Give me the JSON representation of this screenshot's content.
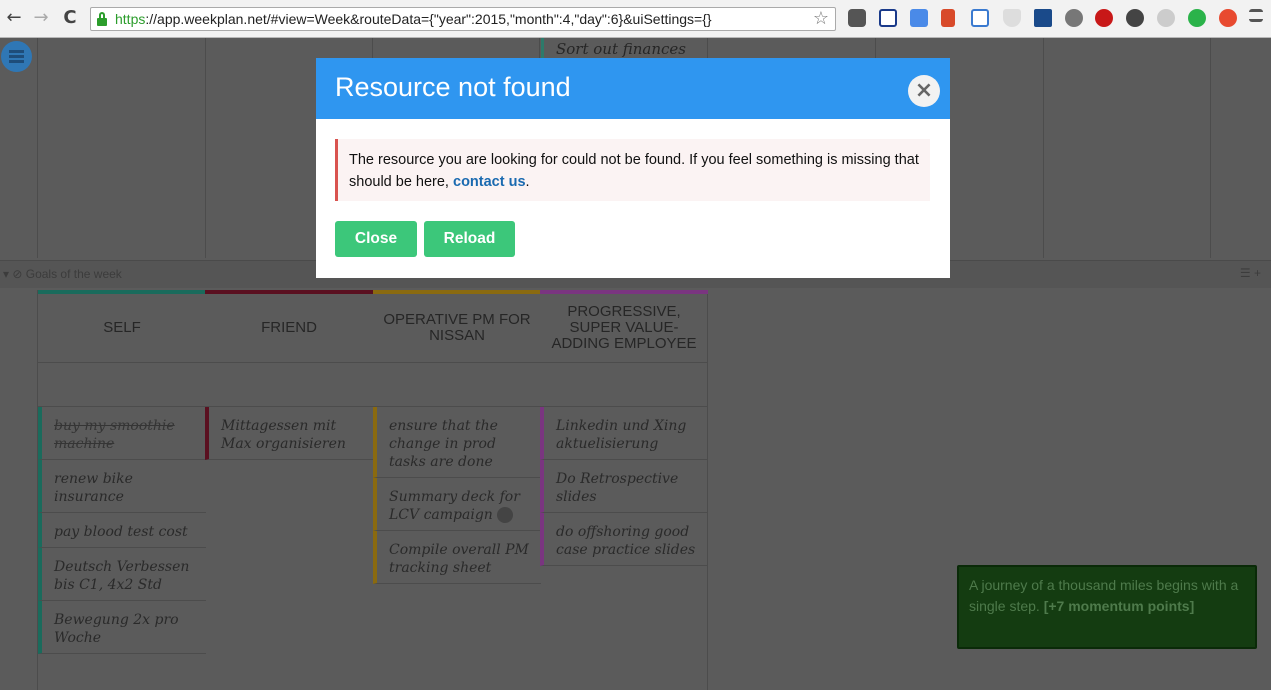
{
  "browser": {
    "back_glyph": "←",
    "forward_glyph": "→",
    "reload_glyph": "C",
    "url_scheme": "https",
    "url_rest": "://app.weekplan.net/#view=Week&routeData={\"year\":2015,\"month\":4,\"day\":6}&uiSettings={}",
    "star_glyph": "☆"
  },
  "schedule": {
    "task": "Sort out finances"
  },
  "goals_bar": {
    "label": "▾ ⊘ Goals of the week",
    "icons": "☰  +"
  },
  "goals": [
    {
      "title": "SELF",
      "color": "#1a6b5c",
      "tasks": [
        {
          "text": "buy my smoothie machine",
          "done": true
        },
        {
          "text": "renew bike insurance",
          "done": false
        },
        {
          "text": "pay blood test cost",
          "done": false
        },
        {
          "text": "Deutsch Verbessen bis C1, 4x2 Std",
          "done": false
        },
        {
          "text": "Bewegung 2x pro Woche",
          "done": false
        }
      ]
    },
    {
      "title": "FRIEND",
      "color": "#5a1020",
      "tasks": [
        {
          "text": "Mittagessen mit Max organisieren",
          "done": false
        }
      ]
    },
    {
      "title": "OPERATIVE PM FOR NISSAN",
      "color": "#8a6a10",
      "tasks": [
        {
          "text": "ensure that the change in prod tasks are done",
          "done": false
        },
        {
          "text": "Summary deck for LCV campaign",
          "done": false
        },
        {
          "text": "Compile overall PM tracking sheet",
          "done": false
        }
      ]
    },
    {
      "title": "PROGRESSIVE, SUPER VALUE-ADDING EMPLOYEE",
      "color": "#7a3580",
      "tasks": [
        {
          "text": "Linkedin und Xing aktuelisierung",
          "done": false
        },
        {
          "text": "Do Retrospective slides",
          "done": false
        },
        {
          "text": "do offshoring good case practice slides",
          "done": false
        }
      ]
    }
  ],
  "modal": {
    "title": "Resource not found",
    "close_glyph": "×",
    "message": "The resource you are looking for could not be found. If you feel something is missing that should be here, ",
    "link": "contact us",
    "message_end": ".",
    "close_label": "Close",
    "reload_label": "Reload"
  },
  "toast": {
    "text": "A journey of a thousand miles begins with a single step. ",
    "bold": "[+7 momentum points]"
  }
}
